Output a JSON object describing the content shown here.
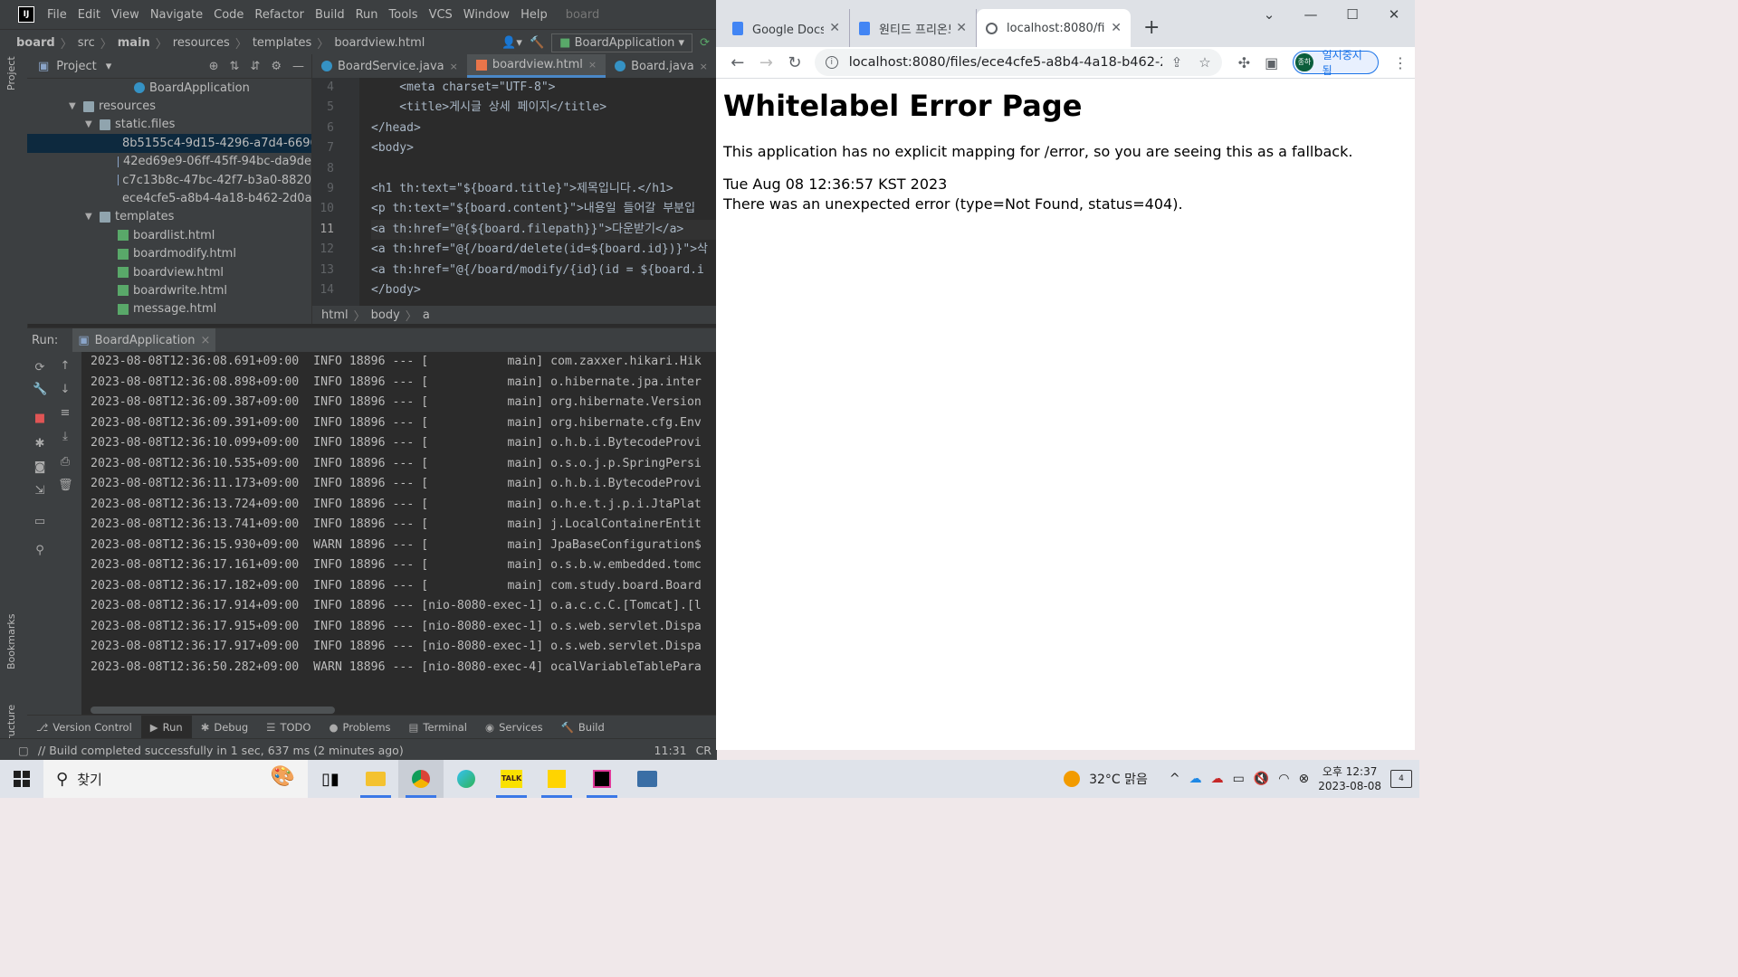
{
  "ide": {
    "menu": [
      "File",
      "Edit",
      "View",
      "Navigate",
      "Code",
      "Refactor",
      "Build",
      "Run",
      "Tools",
      "VCS",
      "Window",
      "Help"
    ],
    "project_name_menu": "board",
    "breadcrumb": [
      "board",
      "src",
      "main",
      "resources",
      "templates",
      "boardview.html"
    ],
    "run_config": "BoardApplication",
    "sidebar_labels": {
      "project": "Project",
      "bookmarks": "Bookmarks",
      "structure": "Structure"
    },
    "project_panel": {
      "title": "Project",
      "tree": [
        {
          "label": "BoardApplication",
          "type": "app",
          "indent": 0
        },
        {
          "label": "resources",
          "type": "folder",
          "indent": 1,
          "expanded": true
        },
        {
          "label": "static.files",
          "type": "folder",
          "indent": 2,
          "expanded": true
        },
        {
          "label": "8b5155c4-9d15-4296-a7d4-6696",
          "type": "file",
          "indent": 3,
          "selected": true
        },
        {
          "label": "42ed69e9-06ff-45ff-94bc-da9de",
          "type": "file",
          "indent": 3
        },
        {
          "label": "c7c13b8c-47bc-42f7-b3a0-8820",
          "type": "file",
          "indent": 3
        },
        {
          "label": "ece4cfe5-a8b4-4a18-b462-2d0a",
          "type": "file",
          "indent": 3
        },
        {
          "label": "templates",
          "type": "folder",
          "indent": 2,
          "expanded": true
        },
        {
          "label": "boardlist.html",
          "type": "html",
          "indent": 3
        },
        {
          "label": "boardmodify.html",
          "type": "html",
          "indent": 3
        },
        {
          "label": "boardview.html",
          "type": "html",
          "indent": 3
        },
        {
          "label": "boardwrite.html",
          "type": "html",
          "indent": 3
        },
        {
          "label": "message.html",
          "type": "html",
          "indent": 3
        }
      ]
    },
    "editor": {
      "tabs": [
        {
          "label": "BoardService.java",
          "kind": "java"
        },
        {
          "label": "boardview.html",
          "kind": "html",
          "active": true
        },
        {
          "label": "Board.java",
          "kind": "java"
        },
        {
          "label": "mes",
          "kind": "html"
        }
      ],
      "lines": [
        {
          "n": "4",
          "text": "    <meta charset=\"UTF-8\">"
        },
        {
          "n": "5",
          "text": "    <title>게시글 상세 페이지</title>"
        },
        {
          "n": "6",
          "text": "</head>"
        },
        {
          "n": "7",
          "text": "<body>"
        },
        {
          "n": "8",
          "text": ""
        },
        {
          "n": "9",
          "text": "<h1 th:text=\"${board.title}\">제목입니다.</h1>"
        },
        {
          "n": "10",
          "text": "<p th:text=\"${board.content}\">내용일 들어갈 부분입"
        },
        {
          "n": "11",
          "text": "<a th:href=\"@{${board.filepath}}\">다운받기</a>",
          "current": true
        },
        {
          "n": "12",
          "text": "<a th:href=\"@{/board/delete(id=${board.id})}\">삭"
        },
        {
          "n": "13",
          "text": "<a th:href=\"@{/board/modify/{id}(id = ${board.i"
        },
        {
          "n": "14",
          "text": "</body>"
        }
      ],
      "breadcrumb": [
        "html",
        "body",
        "a"
      ]
    },
    "run": {
      "label": "Run:",
      "tab": "BoardApplication",
      "log": [
        "2023-08-08T12:36:08.691+09:00  INFO 18896 --- [           main] com.zaxxer.hikari.Hik",
        "2023-08-08T12:36:08.898+09:00  INFO 18896 --- [           main] o.hibernate.jpa.inter",
        "2023-08-08T12:36:09.387+09:00  INFO 18896 --- [           main] org.hibernate.Version",
        "2023-08-08T12:36:09.391+09:00  INFO 18896 --- [           main] org.hibernate.cfg.Env",
        "2023-08-08T12:36:10.099+09:00  INFO 18896 --- [           main] o.h.b.i.BytecodeProvi",
        "2023-08-08T12:36:10.535+09:00  INFO 18896 --- [           main] o.s.o.j.p.SpringPersi",
        "2023-08-08T12:36:11.173+09:00  INFO 18896 --- [           main] o.h.b.i.BytecodeProvi",
        "2023-08-08T12:36:13.724+09:00  INFO 18896 --- [           main] o.h.e.t.j.p.i.JtaPlat",
        "2023-08-08T12:36:13.741+09:00  INFO 18896 --- [           main] j.LocalContainerEntit",
        "2023-08-08T12:36:15.930+09:00  WARN 18896 --- [           main] JpaBaseConfiguration$",
        "2023-08-08T12:36:17.161+09:00  INFO 18896 --- [           main] o.s.b.w.embedded.tomc",
        "2023-08-08T12:36:17.182+09:00  INFO 18896 --- [           main] com.study.board.Board",
        "2023-08-08T12:36:17.914+09:00  INFO 18896 --- [nio-8080-exec-1] o.a.c.c.C.[Tomcat].[l",
        "2023-08-08T12:36:17.915+09:00  INFO 18896 --- [nio-8080-exec-1] o.s.web.servlet.Dispa",
        "2023-08-08T12:36:17.917+09:00  INFO 18896 --- [nio-8080-exec-1] o.s.web.servlet.Dispa",
        "2023-08-08T12:36:50.282+09:00  WARN 18896 --- [nio-8080-exec-4] ocalVariableTablePara"
      ]
    },
    "bottom_tools": [
      "Version Control",
      "Run",
      "Debug",
      "TODO",
      "Problems",
      "Terminal",
      "Services",
      "Build"
    ],
    "status": {
      "message": "// Build completed successfully in 1 sec, 637 ms (2 minutes ago)",
      "position": "11:31",
      "encoding": "CR"
    }
  },
  "browser": {
    "tabs": [
      {
        "label": "Google Docs: 온라",
        "icon": "docs"
      },
      {
        "label": "원티드 프리온보딩",
        "icon": "docs"
      },
      {
        "label": "localhost:8080/file",
        "icon": "globe",
        "active": true
      }
    ],
    "url": "localhost:8080/files/ece4cfe5-a8b4-4a18-b462-2d0...",
    "profile_label": "일시중지됨",
    "avatar_text": "종하",
    "page": {
      "title": "Whitelabel Error Page",
      "message": "This application has no explicit mapping for /error, so you are seeing this as a fallback.",
      "timestamp": "Tue Aug 08 12:36:57 KST 2023",
      "error": "There was an unexpected error (type=Not Found, status=404)."
    }
  },
  "taskbar": {
    "search_label": "찾기",
    "weather": "32°C  맑음",
    "time": "오후 12:37",
    "date": "2023-08-08",
    "notifications": "4",
    "apps": [
      "task-view",
      "file-explorer",
      "chrome",
      "edge",
      "kakaotalk",
      "sticky-notes",
      "intellij",
      "network-tool"
    ],
    "talk_label": "TALK"
  }
}
